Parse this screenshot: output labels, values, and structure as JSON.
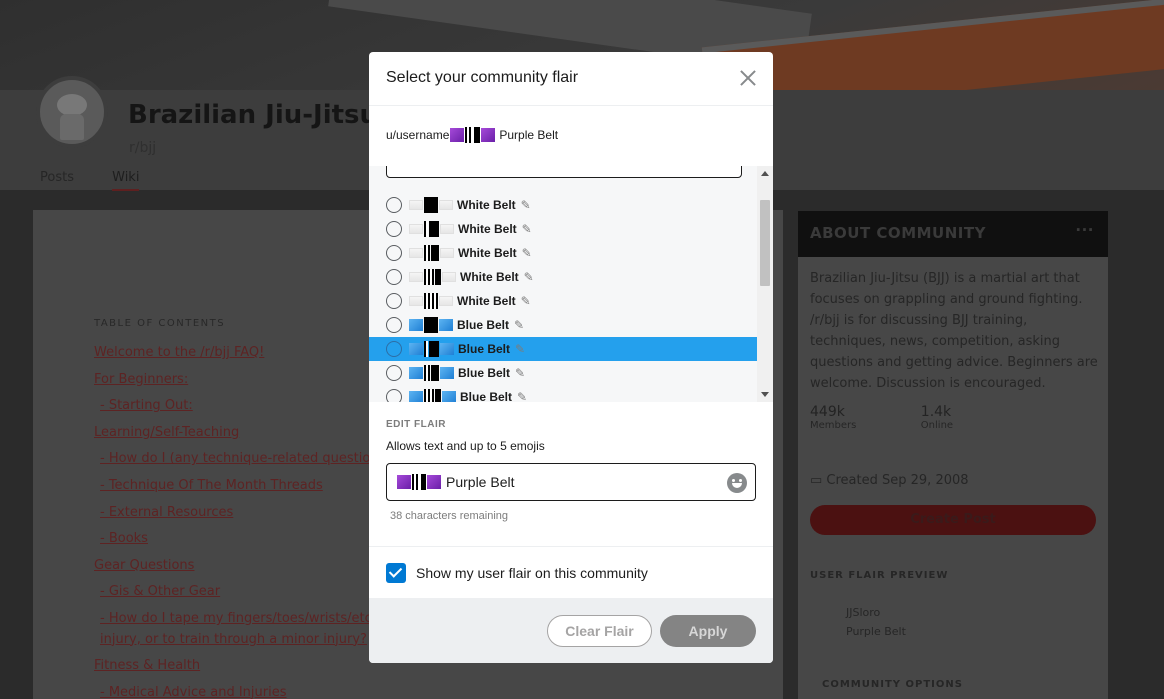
{
  "background": {
    "subreddit_title": "Brazilian Jiu-Jitsu",
    "subreddit_name": "r/bjj",
    "tabs": [
      "Posts",
      "Wiki"
    ],
    "toc_title": "TABLE OF CONTENTS",
    "toc": [
      "Welcome to the /r/bjj FAQ!",
      "For Beginners:",
      " - Starting Out:",
      "Learning/Self-Teaching",
      " - How do I (any technique-related question)?",
      " - Technique Of The Month Threads",
      " - External Resources",
      " - Books",
      "Gear Questions",
      " - Gis & Other Gear",
      " - How do I tape my fingers/toes/wrists/etc?",
      " injury, or to train through a minor injury?",
      "Fitness & Health",
      " - Medical Advice and Injuries"
    ],
    "about_title": "About Community",
    "about_desc": "Brazilian Jiu-Jitsu (BJJ) is a martial art that focuses on grappling and ground fighting. /r/bjj is for discussing BJJ training, techniques, news, competition, asking questions and getting advice. Beginners are welcome. Discussion is encouraged.",
    "members_count": "449k",
    "members_label": "Members",
    "online_count": "1.4k",
    "online_label": "Online",
    "created": "Created Sep 29, 2008",
    "create_post": "Create Post",
    "flair_preview_title": "USER FLAIR PREVIEW",
    "preview_user": "JJSloro",
    "preview_flair": "Purple Belt",
    "community_options": "COMMUNITY OPTIONS"
  },
  "modal": {
    "title": "Select your community flair",
    "preview_username": "u/username",
    "preview_flair_text": "Purple Belt",
    "flair_options": [
      {
        "label": "White Belt",
        "color": "white",
        "stripes": 0
      },
      {
        "label": "White Belt",
        "color": "white",
        "stripes": 1
      },
      {
        "label": "White Belt",
        "color": "white",
        "stripes": 2
      },
      {
        "label": "White Belt",
        "color": "white",
        "stripes": 3
      },
      {
        "label": "White Belt",
        "color": "white",
        "stripes": 4
      },
      {
        "label": "Blue Belt",
        "color": "blue",
        "stripes": 0
      },
      {
        "label": "Blue Belt",
        "color": "blue",
        "stripes": 1,
        "selected": true
      },
      {
        "label": "Blue Belt",
        "color": "blue",
        "stripes": 2
      },
      {
        "label": "Blue Belt",
        "color": "blue",
        "stripes": 3
      }
    ],
    "edit_section_title": "EDIT FLAIR",
    "edit_help": "Allows text and up to 5 emojis",
    "edit_value": "Purple Belt",
    "chars_remaining": "38 characters remaining",
    "show_flair_label": "Show my user flair on this community",
    "show_flair_checked": true,
    "clear_label": "Clear Flair",
    "apply_label": "Apply"
  },
  "colors": {
    "accent_blue": "#0079d3",
    "selected_row": "#24a0ed",
    "purple_emoji": "#8e35c6",
    "blue_emoji": "#2f8fe0"
  },
  "icons": {
    "close": "close-icon",
    "edit": "pencil-icon",
    "emoji": "smiley-icon",
    "checkbox": "checkmark-icon"
  }
}
